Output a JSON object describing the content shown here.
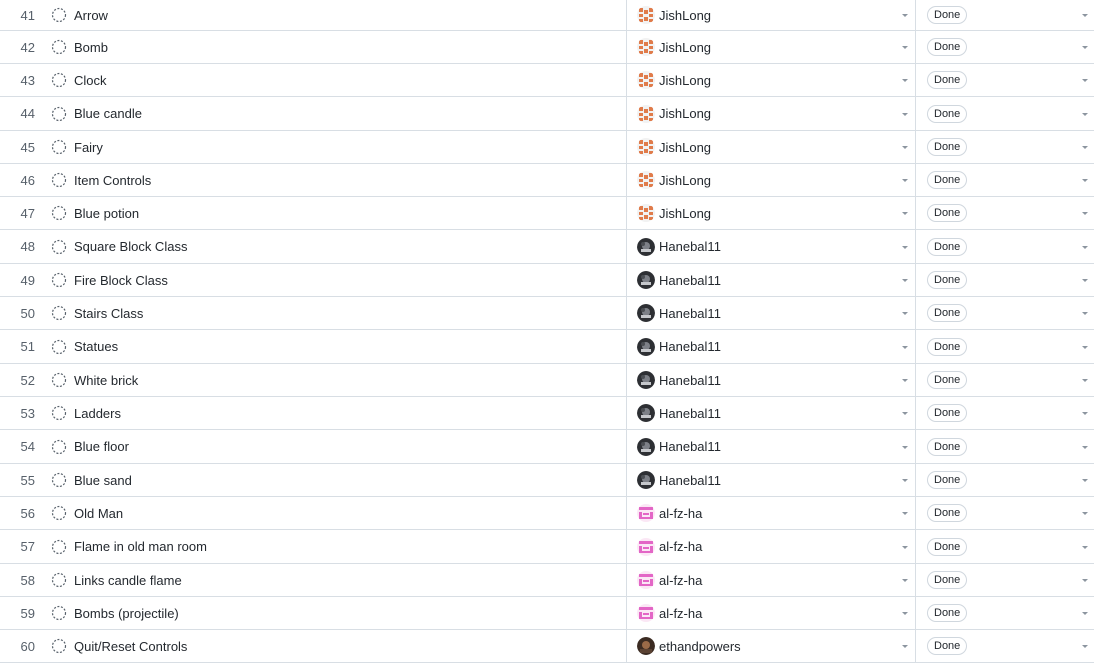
{
  "colors": {
    "border": "#d8dee4",
    "text": "#24292f",
    "muted": "#57606a",
    "caret": "#8c959f",
    "avatar_jishlong": "#e07b4a",
    "avatar_alfzha": "#e366c6"
  },
  "rows": [
    {
      "num": "41",
      "title": "Arrow",
      "icon": "draft-circle-icon",
      "assignee": "JishLong",
      "avatar": "identicon-orange",
      "status": "Done"
    },
    {
      "num": "42",
      "title": "Bomb",
      "icon": "draft-circle-icon",
      "assignee": "JishLong",
      "avatar": "identicon-orange",
      "status": "Done"
    },
    {
      "num": "43",
      "title": "Clock",
      "icon": "draft-circle-icon",
      "assignee": "JishLong",
      "avatar": "identicon-orange",
      "status": "Done"
    },
    {
      "num": "44",
      "title": "Blue candle",
      "icon": "draft-circle-icon",
      "assignee": "JishLong",
      "avatar": "identicon-orange",
      "status": "Done"
    },
    {
      "num": "45",
      "title": "Fairy",
      "icon": "draft-circle-icon",
      "assignee": "JishLong",
      "avatar": "identicon-orange",
      "status": "Done"
    },
    {
      "num": "46",
      "title": "Item Controls",
      "icon": "draft-circle-icon",
      "assignee": "JishLong",
      "avatar": "identicon-orange",
      "status": "Done"
    },
    {
      "num": "47",
      "title": "Blue potion",
      "icon": "draft-circle-icon",
      "assignee": "JishLong",
      "avatar": "identicon-orange",
      "status": "Done"
    },
    {
      "num": "48",
      "title": "Square Block Class",
      "icon": "draft-circle-icon",
      "assignee": "Hanebal11",
      "avatar": "photo-dark",
      "status": "Done"
    },
    {
      "num": "49",
      "title": "Fire Block Class",
      "icon": "draft-circle-icon",
      "assignee": "Hanebal11",
      "avatar": "photo-dark",
      "status": "Done"
    },
    {
      "num": "50",
      "title": "Stairs Class",
      "icon": "draft-circle-icon",
      "assignee": "Hanebal11",
      "avatar": "photo-dark",
      "status": "Done"
    },
    {
      "num": "51",
      "title": "Statues",
      "icon": "draft-circle-icon",
      "assignee": "Hanebal11",
      "avatar": "photo-dark",
      "status": "Done"
    },
    {
      "num": "52",
      "title": "White brick",
      "icon": "draft-circle-icon",
      "assignee": "Hanebal11",
      "avatar": "photo-dark",
      "status": "Done"
    },
    {
      "num": "53",
      "title": "Ladders",
      "icon": "draft-circle-icon",
      "assignee": "Hanebal11",
      "avatar": "photo-dark",
      "status": "Done"
    },
    {
      "num": "54",
      "title": "Blue floor",
      "icon": "draft-circle-icon",
      "assignee": "Hanebal11",
      "avatar": "photo-dark",
      "status": "Done"
    },
    {
      "num": "55",
      "title": "Blue sand",
      "icon": "draft-circle-icon",
      "assignee": "Hanebal11",
      "avatar": "photo-dark",
      "status": "Done"
    },
    {
      "num": "56",
      "title": "Old Man",
      "icon": "draft-circle-icon",
      "assignee": "al-fz-ha",
      "avatar": "identicon-pink",
      "status": "Done"
    },
    {
      "num": "57",
      "title": "Flame in old man room",
      "icon": "draft-circle-icon",
      "assignee": "al-fz-ha",
      "avatar": "identicon-pink",
      "status": "Done"
    },
    {
      "num": "58",
      "title": "Links candle flame",
      "icon": "draft-circle-icon",
      "assignee": "al-fz-ha",
      "avatar": "identicon-pink",
      "status": "Done"
    },
    {
      "num": "59",
      "title": "Bombs (projectile)",
      "icon": "draft-circle-icon",
      "assignee": "al-fz-ha",
      "avatar": "identicon-pink",
      "status": "Done"
    },
    {
      "num": "60",
      "title": "Quit/Reset Controls",
      "icon": "draft-circle-icon",
      "assignee": "ethandpowers",
      "avatar": "photo-brown",
      "status": "Done"
    }
  ]
}
